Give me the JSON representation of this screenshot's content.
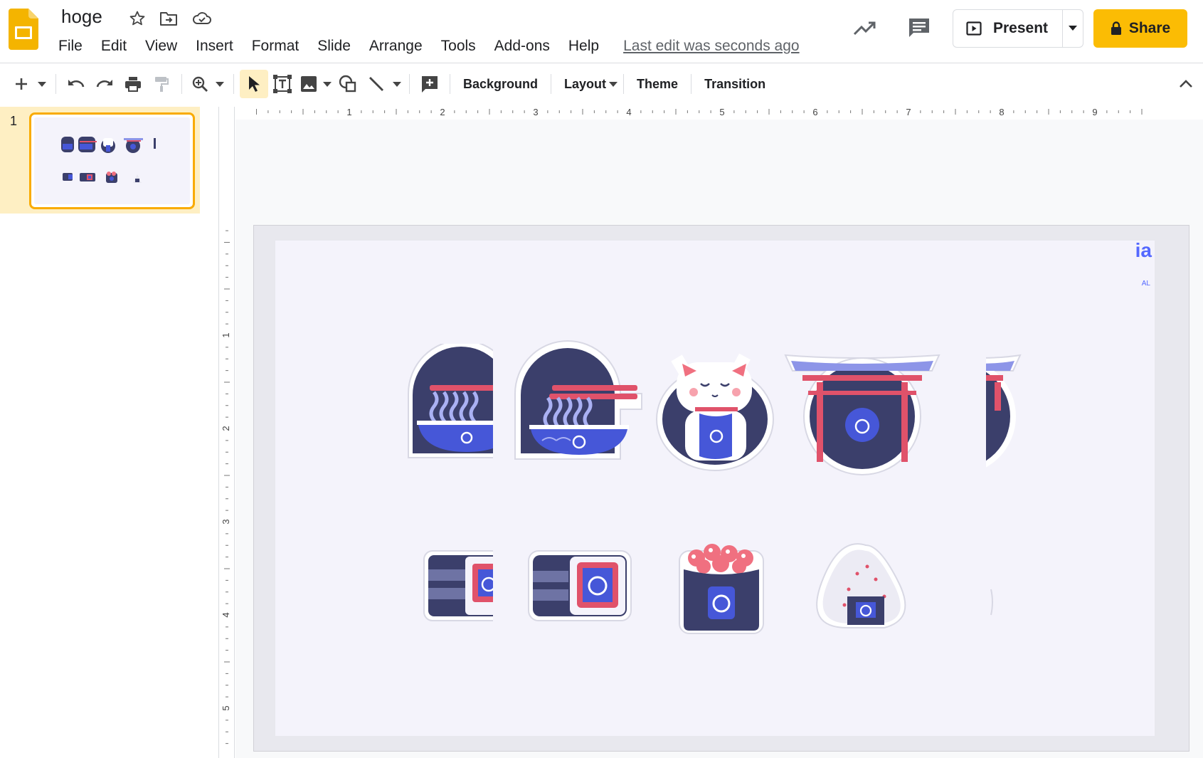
{
  "app": {
    "doc_title": "hoge",
    "last_edit": "Last edit was seconds ago",
    "menu": [
      "File",
      "Edit",
      "View",
      "Insert",
      "Format",
      "Slide",
      "Arrange",
      "Tools",
      "Add-ons",
      "Help"
    ],
    "present_label": "Present",
    "share_label": "Share",
    "accent_color": "#fbbc04"
  },
  "toolbar": {
    "background_label": "Background",
    "layout_label": "Layout",
    "theme_label": "Theme",
    "transition_label": "Transition"
  },
  "filmstrip": {
    "slide_number": "1"
  },
  "ruler": {
    "h_labels": [
      "1",
      "2",
      "3",
      "4",
      "5",
      "6",
      "7",
      "8",
      "9"
    ],
    "v_labels": [
      "1",
      "2",
      "3",
      "4",
      "5"
    ]
  },
  "slide": {
    "corner_text": "ia",
    "corner_badge": "AL",
    "stickers_row1": [
      "ramen-bowl-cropped",
      "ramen-bowl",
      "maneki-neko-cat",
      "torii-gate",
      "torii-gate-cropped"
    ],
    "stickers_row2": [
      "maki-roll-cropped",
      "maki-roll",
      "ikura-gunkan",
      "onigiri",
      "onigiri-cropped"
    ]
  }
}
